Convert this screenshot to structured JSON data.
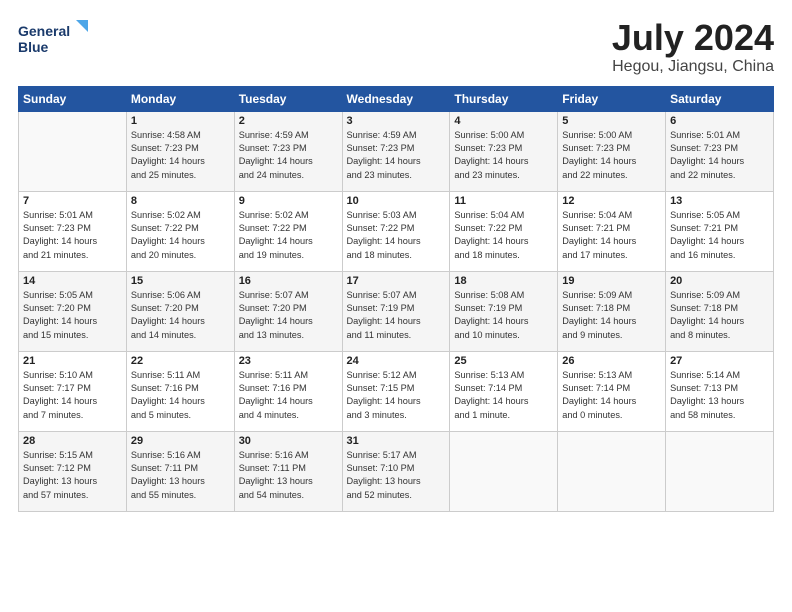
{
  "header": {
    "logo_line1": "General",
    "logo_line2": "Blue",
    "month": "July 2024",
    "location": "Hegou, Jiangsu, China"
  },
  "weekdays": [
    "Sunday",
    "Monday",
    "Tuesday",
    "Wednesday",
    "Thursday",
    "Friday",
    "Saturday"
  ],
  "weeks": [
    [
      {
        "day": "",
        "info": ""
      },
      {
        "day": "1",
        "info": "Sunrise: 4:58 AM\nSunset: 7:23 PM\nDaylight: 14 hours\nand 25 minutes."
      },
      {
        "day": "2",
        "info": "Sunrise: 4:59 AM\nSunset: 7:23 PM\nDaylight: 14 hours\nand 24 minutes."
      },
      {
        "day": "3",
        "info": "Sunrise: 4:59 AM\nSunset: 7:23 PM\nDaylight: 14 hours\nand 23 minutes."
      },
      {
        "day": "4",
        "info": "Sunrise: 5:00 AM\nSunset: 7:23 PM\nDaylight: 14 hours\nand 23 minutes."
      },
      {
        "day": "5",
        "info": "Sunrise: 5:00 AM\nSunset: 7:23 PM\nDaylight: 14 hours\nand 22 minutes."
      },
      {
        "day": "6",
        "info": "Sunrise: 5:01 AM\nSunset: 7:23 PM\nDaylight: 14 hours\nand 22 minutes."
      }
    ],
    [
      {
        "day": "7",
        "info": "Sunrise: 5:01 AM\nSunset: 7:23 PM\nDaylight: 14 hours\nand 21 minutes."
      },
      {
        "day": "8",
        "info": "Sunrise: 5:02 AM\nSunset: 7:22 PM\nDaylight: 14 hours\nand 20 minutes."
      },
      {
        "day": "9",
        "info": "Sunrise: 5:02 AM\nSunset: 7:22 PM\nDaylight: 14 hours\nand 19 minutes."
      },
      {
        "day": "10",
        "info": "Sunrise: 5:03 AM\nSunset: 7:22 PM\nDaylight: 14 hours\nand 18 minutes."
      },
      {
        "day": "11",
        "info": "Sunrise: 5:04 AM\nSunset: 7:22 PM\nDaylight: 14 hours\nand 18 minutes."
      },
      {
        "day": "12",
        "info": "Sunrise: 5:04 AM\nSunset: 7:21 PM\nDaylight: 14 hours\nand 17 minutes."
      },
      {
        "day": "13",
        "info": "Sunrise: 5:05 AM\nSunset: 7:21 PM\nDaylight: 14 hours\nand 16 minutes."
      }
    ],
    [
      {
        "day": "14",
        "info": "Sunrise: 5:05 AM\nSunset: 7:20 PM\nDaylight: 14 hours\nand 15 minutes."
      },
      {
        "day": "15",
        "info": "Sunrise: 5:06 AM\nSunset: 7:20 PM\nDaylight: 14 hours\nand 14 minutes."
      },
      {
        "day": "16",
        "info": "Sunrise: 5:07 AM\nSunset: 7:20 PM\nDaylight: 14 hours\nand 13 minutes."
      },
      {
        "day": "17",
        "info": "Sunrise: 5:07 AM\nSunset: 7:19 PM\nDaylight: 14 hours\nand 11 minutes."
      },
      {
        "day": "18",
        "info": "Sunrise: 5:08 AM\nSunset: 7:19 PM\nDaylight: 14 hours\nand 10 minutes."
      },
      {
        "day": "19",
        "info": "Sunrise: 5:09 AM\nSunset: 7:18 PM\nDaylight: 14 hours\nand 9 minutes."
      },
      {
        "day": "20",
        "info": "Sunrise: 5:09 AM\nSunset: 7:18 PM\nDaylight: 14 hours\nand 8 minutes."
      }
    ],
    [
      {
        "day": "21",
        "info": "Sunrise: 5:10 AM\nSunset: 7:17 PM\nDaylight: 14 hours\nand 7 minutes."
      },
      {
        "day": "22",
        "info": "Sunrise: 5:11 AM\nSunset: 7:16 PM\nDaylight: 14 hours\nand 5 minutes."
      },
      {
        "day": "23",
        "info": "Sunrise: 5:11 AM\nSunset: 7:16 PM\nDaylight: 14 hours\nand 4 minutes."
      },
      {
        "day": "24",
        "info": "Sunrise: 5:12 AM\nSunset: 7:15 PM\nDaylight: 14 hours\nand 3 minutes."
      },
      {
        "day": "25",
        "info": "Sunrise: 5:13 AM\nSunset: 7:14 PM\nDaylight: 14 hours\nand 1 minute."
      },
      {
        "day": "26",
        "info": "Sunrise: 5:13 AM\nSunset: 7:14 PM\nDaylight: 14 hours\nand 0 minutes."
      },
      {
        "day": "27",
        "info": "Sunrise: 5:14 AM\nSunset: 7:13 PM\nDaylight: 13 hours\nand 58 minutes."
      }
    ],
    [
      {
        "day": "28",
        "info": "Sunrise: 5:15 AM\nSunset: 7:12 PM\nDaylight: 13 hours\nand 57 minutes."
      },
      {
        "day": "29",
        "info": "Sunrise: 5:16 AM\nSunset: 7:11 PM\nDaylight: 13 hours\nand 55 minutes."
      },
      {
        "day": "30",
        "info": "Sunrise: 5:16 AM\nSunset: 7:11 PM\nDaylight: 13 hours\nand 54 minutes."
      },
      {
        "day": "31",
        "info": "Sunrise: 5:17 AM\nSunset: 7:10 PM\nDaylight: 13 hours\nand 52 minutes."
      },
      {
        "day": "",
        "info": ""
      },
      {
        "day": "",
        "info": ""
      },
      {
        "day": "",
        "info": ""
      }
    ]
  ]
}
